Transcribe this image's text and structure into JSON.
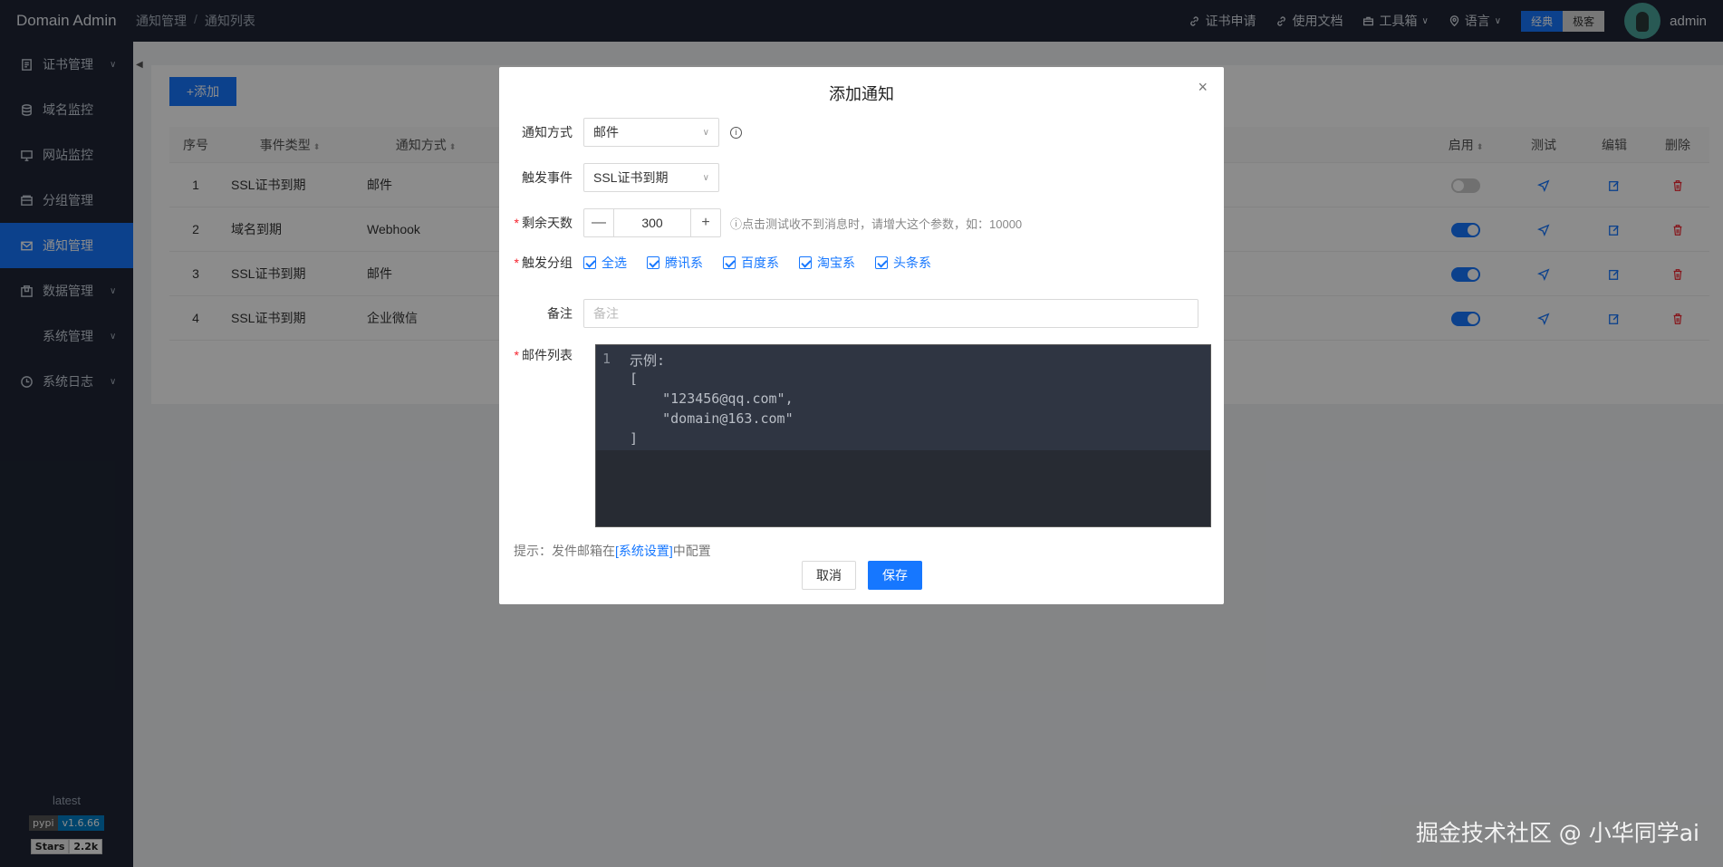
{
  "header": {
    "brand": "Domain Admin",
    "breadcrumb": [
      "通知管理",
      "通知列表"
    ],
    "breadcrumb_sep": "/",
    "links": [
      {
        "label": "证书申请",
        "icon": "link-icon"
      },
      {
        "label": "使用文档",
        "icon": "link-icon"
      },
      {
        "label": "工具箱",
        "icon": "toolbox-icon"
      },
      {
        "label": "语言",
        "icon": "location-icon"
      }
    ],
    "mode_on": "经典",
    "mode_off": "极客",
    "username": "admin"
  },
  "sidebar": {
    "items": [
      {
        "label": "证书管理",
        "icon": "certificate-icon",
        "chevron": "∨"
      },
      {
        "label": "域名监控",
        "icon": "database-icon",
        "chevron": ""
      },
      {
        "label": "网站监控",
        "icon": "monitor-icon",
        "chevron": ""
      },
      {
        "label": "分组管理",
        "icon": "folder-icon",
        "chevron": ""
      },
      {
        "label": "通知管理",
        "icon": "mail-icon",
        "chevron": ""
      },
      {
        "label": "数据管理",
        "icon": "package-icon",
        "chevron": "∨"
      },
      {
        "label": "系统管理",
        "icon": "",
        "chevron": "∨"
      },
      {
        "label": "系统日志",
        "icon": "clock-icon",
        "chevron": "∨"
      }
    ],
    "active_index": 4,
    "version_label": "latest",
    "pypi_badge": {
      "left": "pypi",
      "right": "v1.6.66"
    },
    "stars_badge": {
      "left": "Stars",
      "right": "2.2k"
    }
  },
  "list": {
    "add_label": "+添加",
    "columns": {
      "idx": "序号",
      "event": "事件类型",
      "way": "通知方式",
      "enabled": "启用",
      "test": "测试",
      "edit": "编辑",
      "delete": "删除"
    },
    "rows": [
      {
        "idx": "1",
        "event": "SSL证书到期",
        "way": "邮件",
        "enabled": false
      },
      {
        "idx": "2",
        "event": "域名到期",
        "way": "Webhook",
        "enabled": true
      },
      {
        "idx": "3",
        "event": "SSL证书到期",
        "way": "邮件",
        "enabled": true
      },
      {
        "idx": "4",
        "event": "SSL证书到期",
        "way": "企业微信",
        "enabled": true
      }
    ]
  },
  "modal": {
    "title": "添加通知",
    "close": "×",
    "notify_way_label": "通知方式",
    "notify_way_value": "邮件",
    "trigger_event_label": "触发事件",
    "trigger_event_value": "SSL证书到期",
    "days_label": "剩余天数",
    "days_value": "300",
    "days_minus": "—",
    "days_plus": "+",
    "days_hint": "ⓘ点击测试收不到消息时，请增大这个参数，如：10000",
    "group_label": "触发分组",
    "groups": [
      "全选",
      "腾讯系",
      "百度系",
      "淘宝系",
      "头条系"
    ],
    "remark_label": "备注",
    "remark_placeholder": "备注",
    "email_label": "邮件列表",
    "editor_line_number": "1",
    "editor_lines": [
      "示例:",
      "[",
      "    \"123456@qq.com\",",
      "    \"domain@163.com\"",
      "]"
    ],
    "tip_prefix": "提示：发件邮箱在",
    "tip_link": "[系统设置]",
    "tip_suffix": "中配置",
    "cancel": "取消",
    "save": "保存"
  },
  "watermark": "掘金技术社区 @ 小华同学ai"
}
